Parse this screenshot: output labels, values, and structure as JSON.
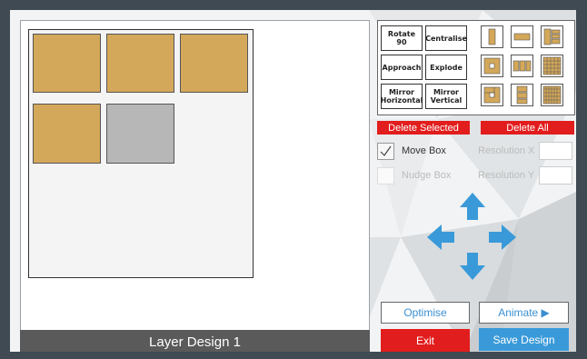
{
  "canvas": {
    "layer_title": "Layer Design 1"
  },
  "tools": {
    "rotate": "Rotate 90",
    "centralise": "Centralise",
    "approach": "Approach",
    "explode": "Explode",
    "mirror_h_line1": "Mirror",
    "mirror_h_line2": "Horizontal",
    "mirror_v_line1": "Mirror",
    "mirror_v_line2": "Vertical",
    "delete_selected": "Delete Selected",
    "delete_all": "Delete All"
  },
  "options": {
    "move_box": "Move Box",
    "move_box_checked": true,
    "nudge_box": "Nudge Box",
    "nudge_box_checked": false,
    "resolution_x": "Resolution X",
    "resolution_y": "Resolution Y"
  },
  "actions": {
    "optimise": "Optimise",
    "animate": "Animate ▶",
    "exit": "Exit",
    "save_design": "Save Design"
  },
  "colors": {
    "piece": "#d4a85a",
    "piece_selected": "#b7b7b7",
    "danger": "#e21d1d",
    "accent": "#3a9ad9"
  }
}
